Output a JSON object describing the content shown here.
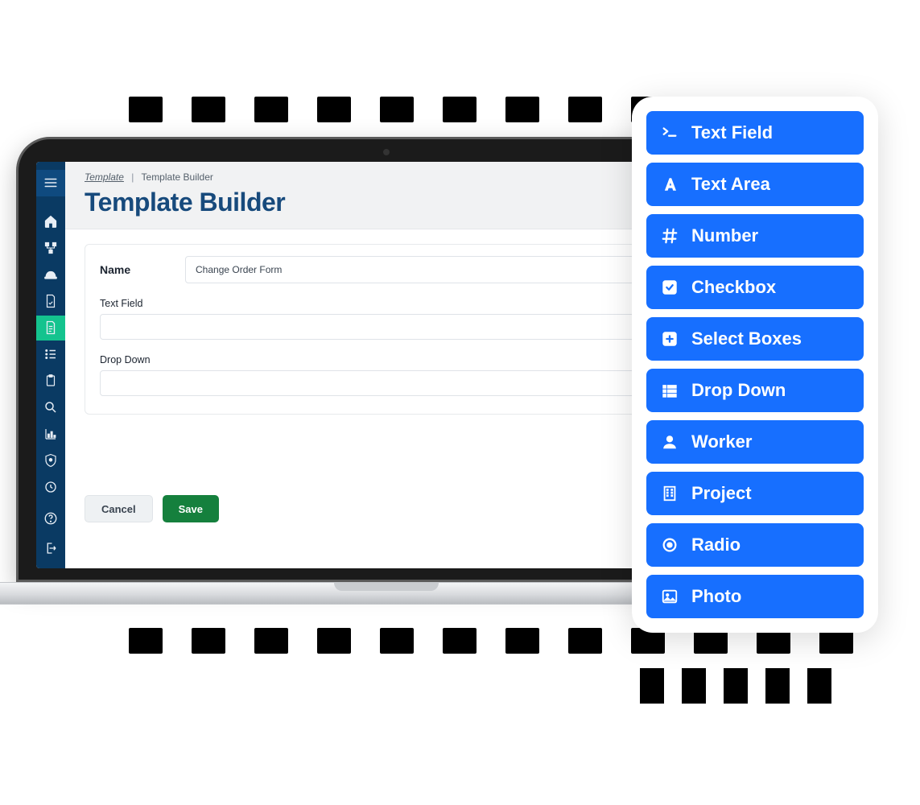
{
  "breadcrumb": {
    "root": "Template",
    "current": "Template Builder"
  },
  "page": {
    "title": "Template Builder"
  },
  "form": {
    "name_label": "Name",
    "name_value": "Change Order Form",
    "fields": [
      {
        "label": "Text Field"
      },
      {
        "label": "Drop Down"
      }
    ]
  },
  "buttons": {
    "cancel": "Cancel",
    "save": "Save"
  },
  "sidebar": {
    "items": [
      {
        "name": "home-icon"
      },
      {
        "name": "tree-icon"
      },
      {
        "name": "hardhat-icon"
      },
      {
        "name": "document-icon"
      },
      {
        "name": "file-icon",
        "active": true
      },
      {
        "name": "list-icon"
      },
      {
        "name": "clipboard-icon"
      },
      {
        "name": "search-icon"
      },
      {
        "name": "chart-icon"
      },
      {
        "name": "shield-icon"
      },
      {
        "name": "clock-icon"
      }
    ],
    "bottom": [
      {
        "name": "help-icon"
      },
      {
        "name": "logout-icon"
      }
    ]
  },
  "palette": [
    {
      "icon": "terminal-icon",
      "label": "Text Field"
    },
    {
      "icon": "font-icon",
      "label": "Text Area"
    },
    {
      "icon": "hash-icon",
      "label": "Number"
    },
    {
      "icon": "checkbox-icon",
      "label": "Checkbox"
    },
    {
      "icon": "plus-box-icon",
      "label": "Select Boxes"
    },
    {
      "icon": "list-icon",
      "label": "Drop Down"
    },
    {
      "icon": "user-icon",
      "label": "Worker"
    },
    {
      "icon": "building-icon",
      "label": "Project"
    },
    {
      "icon": "radio-icon",
      "label": "Radio"
    },
    {
      "icon": "image-icon",
      "label": "Photo"
    }
  ]
}
